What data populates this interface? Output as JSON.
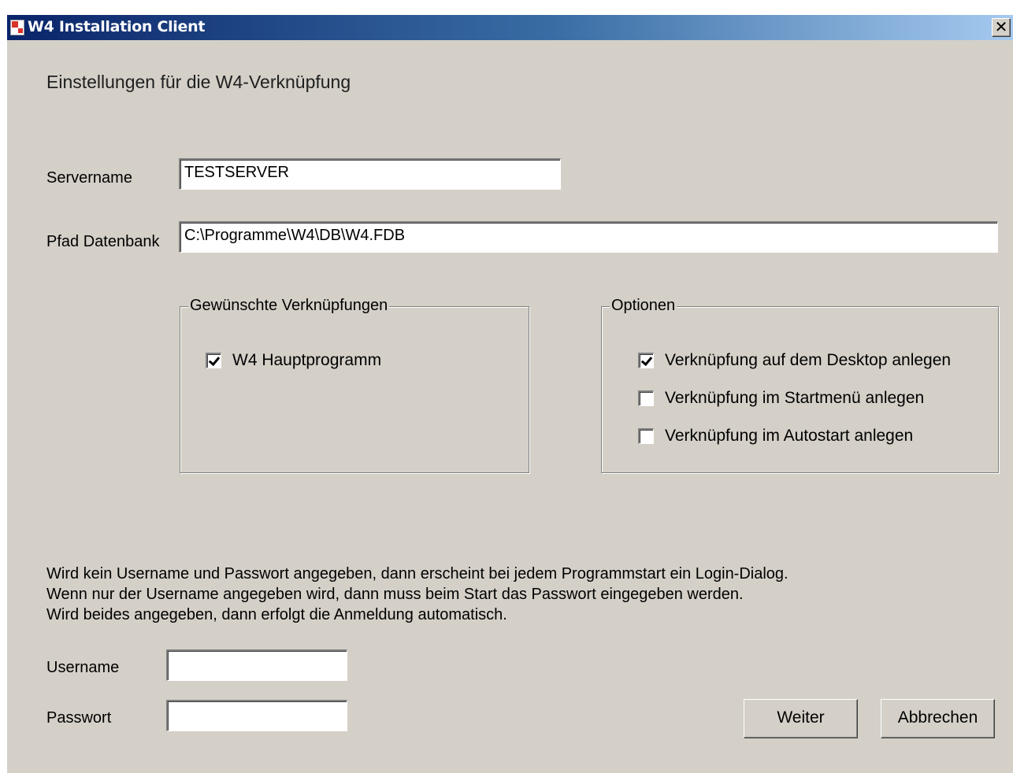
{
  "window": {
    "title": "W4 Installation Client",
    "close_symbol": "✕",
    "app_icon": "app-icon"
  },
  "heading": "Einstellungen für die W4-Verknüpfung",
  "server": {
    "label": "Servername",
    "value": "TESTSERVER"
  },
  "db_path": {
    "label": "Pfad Datenbank",
    "value": "C:\\Programme\\W4\\DB\\W4.FDB"
  },
  "shortcuts_group": {
    "title": "Gewünschte Verknüpfungen",
    "items": [
      {
        "label": "W4 Hauptprogramm",
        "checked": true
      }
    ]
  },
  "options_group": {
    "title": "Optionen",
    "items": [
      {
        "label": "Verknüpfung auf dem Desktop anlegen",
        "checked": true
      },
      {
        "label": "Verknüpfung im Startmenü anlegen",
        "checked": false
      },
      {
        "label": "Verknüpfung im Autostart anlegen",
        "checked": false
      }
    ]
  },
  "info_lines": [
    "Wird kein Username und Passwort angegeben, dann erscheint bei jedem Programmstart ein Login-Dialog.",
    "Wenn nur der Username angegeben wird, dann muss beim Start das Passwort eingegeben werden.",
    "Wird beides angegeben, dann erfolgt die Anmeldung automatisch."
  ],
  "username": {
    "label": "Username",
    "value": ""
  },
  "password": {
    "label": "Passwort",
    "value": ""
  },
  "buttons": {
    "next": "Weiter",
    "cancel": "Abbrechen"
  },
  "colors": {
    "title_start": "#0a246a",
    "title_end": "#a6caf0",
    "face": "#d4d0c8"
  }
}
